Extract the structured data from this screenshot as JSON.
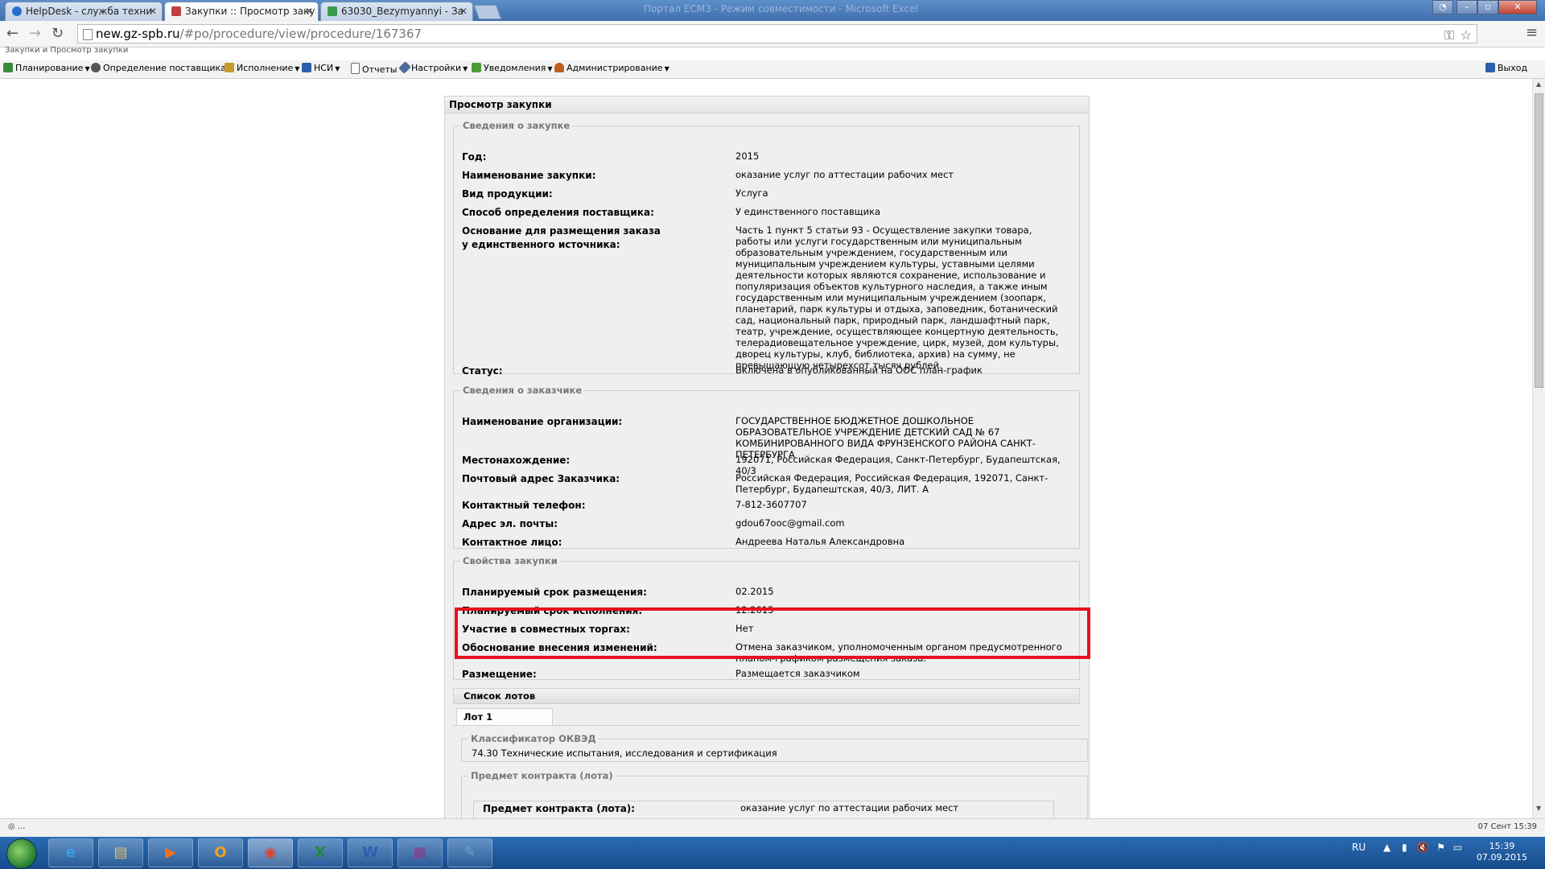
{
  "browser": {
    "tabs": [
      {
        "title": "HelpDesk - служба техни",
        "active": false
      },
      {
        "title": "Закупки :: Просмотр заку",
        "active": true
      },
      {
        "title": "63030_Bezymyannyi - За",
        "active": false
      }
    ],
    "window_title": "Портал ЕСМЗ - Режим совместимости - Microsoft Excel",
    "url_host": "new.gz-spb.ru",
    "url_path": "/#po/procedure/view/procedure/167367"
  },
  "app": {
    "breadcrumb": "Закупки и Просмотр закупки",
    "menu": [
      {
        "label": "Планирование",
        "icon": "planning-icon",
        "color": "#3a8a3a",
        "dropdown": true
      },
      {
        "label": "Определение поставщика",
        "icon": "supplier-icon",
        "color": "#555555",
        "dropdown": true
      },
      {
        "label": "Исполнение",
        "icon": "execution-icon",
        "color": "#c89a2a",
        "dropdown": true
      },
      {
        "label": "НСИ",
        "icon": "directory-icon",
        "color": "#2a5fb0",
        "dropdown": true
      },
      {
        "label": "Отчеты",
        "icon": "reports-icon",
        "color": "#6a6a6a",
        "dropdown": false
      },
      {
        "label": "Настройки",
        "icon": "settings-wrench-icon",
        "color": "#4a6a9a",
        "dropdown": true
      },
      {
        "label": "Уведомления",
        "icon": "notifications-icon",
        "color": "#4a9a3a",
        "dropdown": true
      },
      {
        "label": "Администрирование",
        "icon": "admin-user-icon",
        "color": "#c06020",
        "dropdown": true
      }
    ],
    "exit_label": "Выход"
  },
  "panel": {
    "title": "Просмотр закупки",
    "purchase_info": {
      "legend": "Сведения о закупке",
      "rows": [
        {
          "label": "Год:",
          "value": "2015"
        },
        {
          "label": "Наименование закупки:",
          "value": "оказание услуг по аттестации рабочих мест"
        },
        {
          "label": "Вид продукции:",
          "value": "Услуга"
        },
        {
          "label": "Способ определения поставщика:",
          "value": "У единственного поставщика"
        },
        {
          "label": "Основание для размещения заказа у единственного источника:",
          "value": "Часть 1 пункт 5 статьи 93 - Осуществление закупки товара, работы или услуги государственным или муниципальным образовательным учреждением, государственным или муниципальным учреждением культуры, уставными целями деятельности которых являются сохранение, использование и популяризация объектов культурного наследия, а также иным государственным или муниципальным учреждением (зоопарк, планетарий, парк культуры и отдыха, заповедник, ботанический сад, национальный парк, природный парк, ландшафтный парк, театр, учреждение, осуществляющее концертную деятельность, телерадиовещательное учреждение, цирк, музей, дом культуры, дворец культуры, клуб, библиотека, архив) на сумму, не превышающую четырехсот тысяч рублей."
        },
        {
          "label": "Статус:",
          "value": "Включена в опубликованный на ООС план-график"
        }
      ]
    },
    "customer_info": {
      "legend": "Сведения о заказчике",
      "rows": [
        {
          "label": "Наименование организации:",
          "value": "ГОСУДАРСТВЕННОЕ БЮДЖЕТНОЕ ДОШКОЛЬНОЕ ОБРАЗОВАТЕЛЬНОЕ УЧРЕЖДЕНИЕ ДЕТСКИЙ САД № 67 КОМБИНИРОВАННОГО ВИДА ФРУНЗЕНСКОГО РАЙОНА САНКТ-ПЕТЕРБУРГА"
        },
        {
          "label": "Местонахождение:",
          "value": "192071, Российская Федерация, Санкт-Петербург, Будапештская, 40/3"
        },
        {
          "label": "Почтовый адрес Заказчика:",
          "value": "Российская Федерация, Российская Федерация, 192071, Санкт-Петербург, Будапештская, 40/3, ЛИТ. А"
        },
        {
          "label": "Контактный телефон:",
          "value": "7-812-3607707"
        },
        {
          "label": "Адрес эл. почты:",
          "value": "gdou67ooc@gmail.com"
        },
        {
          "label": "Контактное лицо:",
          "value": "Андреева Наталья Александровна"
        }
      ]
    },
    "properties": {
      "legend": "Свойства закупки",
      "rows": [
        {
          "label": "Планируемый срок размещения:",
          "value": "02.2015"
        },
        {
          "label": "Планируемый срок исполнения:",
          "value": "12.2015"
        },
        {
          "label": "Участие в совместных торгах:",
          "value": "Нет"
        },
        {
          "label": "Обоснование внесения изменений:",
          "value": "Отмена заказчиком, уполномоченным органом предусмотренного планом-графиком размещения заказа."
        },
        {
          "label": "Размещение:",
          "value": "Размещается заказчиком"
        }
      ]
    },
    "lots": {
      "title": "Список лотов",
      "tab": "Лот 1",
      "okved_legend": "Классификатор ОКВЭД",
      "okved_value": "74.30 Технические испытания, исследования и сертификация",
      "contract_legend": "Предмет контракта (лота)",
      "contract_label": "Предмет контракта (лота):",
      "contract_value": "оказание услуг по аттестации рабочих мест"
    }
  },
  "statusbar": {
    "left": "◎ ...",
    "right": "07 Сент 15:39"
  },
  "taskbar": {
    "apps": [
      {
        "name": "ie",
        "glyph": "e",
        "color": "#3aa0e8"
      },
      {
        "name": "explorer",
        "glyph": "▤",
        "color": "#e8c060"
      },
      {
        "name": "media-player",
        "glyph": "▶",
        "color": "#f07020"
      },
      {
        "name": "outlook",
        "glyph": "O",
        "color": "#f0a020"
      },
      {
        "name": "chrome",
        "glyph": "◉",
        "color": "#e04030"
      },
      {
        "name": "excel",
        "glyph": "X",
        "color": "#1f8a3a"
      },
      {
        "name": "word",
        "glyph": "W",
        "color": "#2a5fb0"
      },
      {
        "name": "winrar",
        "glyph": "▦",
        "color": "#8a3a8a"
      },
      {
        "name": "tool",
        "glyph": "✎",
        "color": "#6aa0d0"
      }
    ],
    "lang": "RU",
    "time": "15:39",
    "date": "07.09.2015"
  },
  "colors": {
    "highlight": "#e8101e",
    "taskbar": "#1f5aa0"
  }
}
